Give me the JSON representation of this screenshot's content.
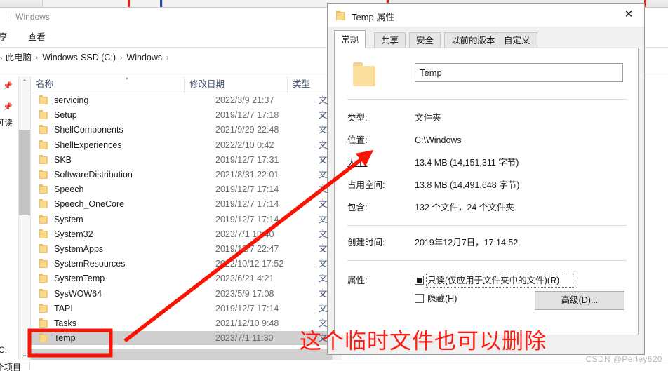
{
  "browser_strip": {
    "tab_labels": [
      "...",
      "........."
    ]
  },
  "explorer": {
    "title": "Windows",
    "title_separator": "|",
    "ribbon_tabs": [
      {
        "label": "享"
      },
      {
        "label": "查看"
      }
    ],
    "breadcrumb": {
      "lead_chevron": "›",
      "items": [
        "此电脑",
        "Windows-SSD (C:)",
        "Windows"
      ],
      "separator": "›",
      "trailing_separator": "›"
    },
    "nav_pane": {
      "pin_icon": "📌",
      "clipped_label_top": "可读",
      "clipped_label_bottom": "(C:"
    },
    "columns": [
      {
        "key": "name",
        "label": "名称"
      },
      {
        "key": "date",
        "label": "修改日期"
      },
      {
        "key": "type",
        "label": "类型"
      }
    ],
    "sort_indicator": "^",
    "rows": [
      {
        "name": "servicing",
        "date": "2022/3/9 21:37",
        "type": "文件夹",
        "selected": false
      },
      {
        "name": "Setup",
        "date": "2019/12/7 17:18",
        "type": "文件夹",
        "selected": false
      },
      {
        "name": "ShellComponents",
        "date": "2021/9/29 22:48",
        "type": "文件夹",
        "selected": false
      },
      {
        "name": "ShellExperiences",
        "date": "2022/2/10 0:42",
        "type": "文件夹",
        "selected": false
      },
      {
        "name": "SKB",
        "date": "2019/12/7 17:31",
        "type": "文件夹",
        "selected": false
      },
      {
        "name": "SoftwareDistribution",
        "date": "2021/8/31 22:01",
        "type": "文件夹",
        "selected": false
      },
      {
        "name": "Speech",
        "date": "2019/12/7 17:14",
        "type": "文件夹",
        "selected": false
      },
      {
        "name": "Speech_OneCore",
        "date": "2019/12/7 17:14",
        "type": "文件夹",
        "selected": false
      },
      {
        "name": "System",
        "date": "2019/12/7 17:14",
        "type": "文件夹",
        "selected": false
      },
      {
        "name": "System32",
        "date": "2023/7/1 10:40",
        "type": "文件夹",
        "selected": false
      },
      {
        "name": "SystemApps",
        "date": "2019/12/7 22:47",
        "type": "文件夹",
        "selected": false
      },
      {
        "name": "SystemResources",
        "date": "2022/10/12 17:52",
        "type": "文件夹",
        "selected": false
      },
      {
        "name": "SystemTemp",
        "date": "2023/6/21 4:21",
        "type": "文件夹",
        "selected": false
      },
      {
        "name": "SysWOW64",
        "date": "2023/5/9 17:08",
        "type": "文件夹",
        "selected": false
      },
      {
        "name": "TAPI",
        "date": "2019/12/7 17:14",
        "type": "文件夹",
        "selected": false
      },
      {
        "name": "Tasks",
        "date": "2021/12/10 9:48",
        "type": "文件夹",
        "selected": false
      },
      {
        "name": "Temp",
        "date": "2023/7/1 11:30",
        "type": "文件夹",
        "selected": true
      }
    ],
    "status_bar": {
      "count_label": "个项目"
    },
    "scroll": {
      "up_arrow": "⌃",
      "down_arrow": "⌄",
      "hscroll_left_arrow": "‹"
    }
  },
  "properties_dialog": {
    "title": "Temp 属性",
    "folder_icon": "folder-icon",
    "close_label": "✕",
    "tabs": [
      {
        "label": "常规",
        "active": true
      },
      {
        "label": "共享",
        "active": false
      },
      {
        "label": "安全",
        "active": false
      },
      {
        "label": "以前的版本",
        "active": false
      },
      {
        "label": "自定义",
        "active": false
      }
    ],
    "name_value": "Temp",
    "fields": [
      {
        "label": "类型:",
        "value": "文件夹",
        "underlined": false
      },
      {
        "label": "位置:",
        "value": "C:\\Windows",
        "underlined": true
      },
      {
        "label": "大小:",
        "value": "13.4 MB (14,151,311 字节)",
        "underlined": true
      },
      {
        "label": "占用空间:",
        "value": "13.8 MB (14,491,648 字节)",
        "underlined": false
      },
      {
        "label": "包含:",
        "value": "132 个文件，24 个文件夹",
        "underlined": false
      },
      {
        "label": "创建时间:",
        "value": "2019年12月7日，17:14:52",
        "underlined": false
      }
    ],
    "attributes": {
      "label": "属性:",
      "readonly": {
        "text": "只读(仅应用于文件夹中的文件)(R)",
        "state": "mixed"
      },
      "hidden": {
        "text": "隐藏(H)",
        "state": "unchecked"
      },
      "advanced_button": "高级(D)..."
    }
  },
  "annotations": {
    "note_text": "这个临时文件也可以删除",
    "note_color": "#fd1a11",
    "arrow_color": "#fa1405",
    "highlight_box_color": "#fa1405",
    "watermark": "CSDN @Perley620"
  }
}
